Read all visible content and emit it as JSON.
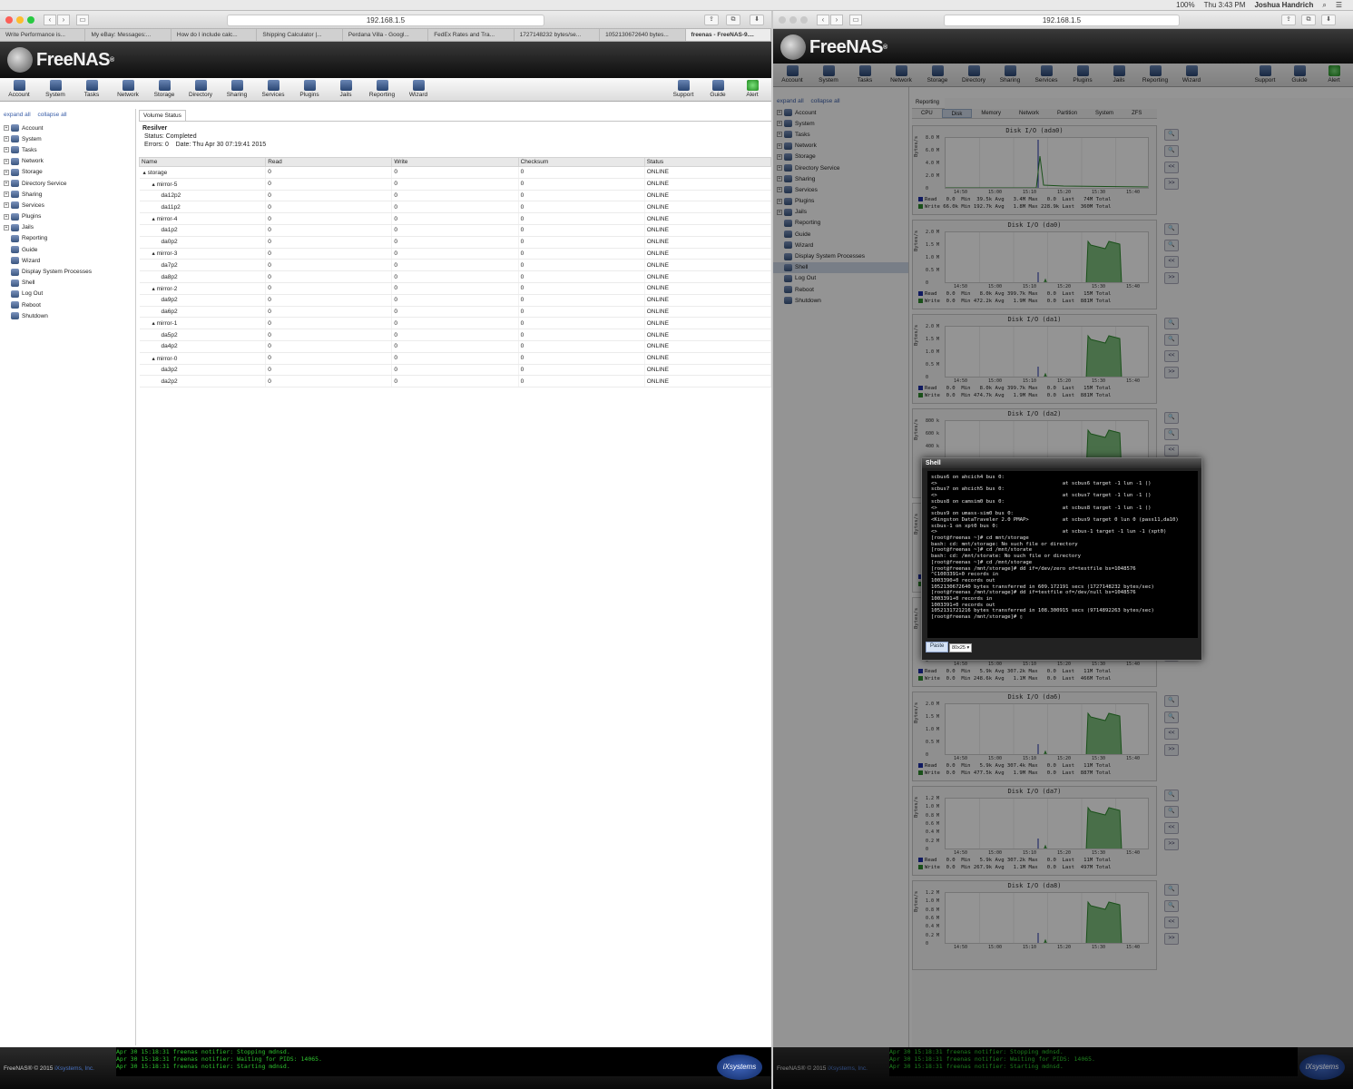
{
  "menubar": {
    "battery": "100%",
    "clock": "Thu 3:43 PM",
    "user": "Joshua Handrich"
  },
  "left_window": {
    "address": "192.168.1.5",
    "tabs": [
      "Write Performance is...",
      "My eBay: Messages:...",
      "How do I include calc...",
      "Shipping Calculator |...",
      "Perdana Villa - Googl...",
      "FedEx Rates and Tra...",
      "1727148232 bytes/se...",
      "1052130672640 bytes...",
      "freenas - FreeNAS-9...."
    ],
    "logo_text": "FreeNAS",
    "toolbar": [
      "Account",
      "System",
      "Tasks",
      "Network",
      "Storage",
      "Directory",
      "Sharing",
      "Services",
      "Plugins",
      "Jails",
      "Reporting",
      "Wizard"
    ],
    "toolbar_right": [
      "Support",
      "Guide",
      "Alert"
    ],
    "tree_links": {
      "expand": "expand all",
      "collapse": "collapse all"
    },
    "tree": [
      {
        "label": "Account",
        "exp": true
      },
      {
        "label": "System",
        "exp": true
      },
      {
        "label": "Tasks",
        "exp": true
      },
      {
        "label": "Network",
        "exp": true
      },
      {
        "label": "Storage",
        "exp": true
      },
      {
        "label": "Directory Service",
        "exp": true
      },
      {
        "label": "Sharing",
        "exp": true
      },
      {
        "label": "Services",
        "exp": true
      },
      {
        "label": "Plugins",
        "exp": true
      },
      {
        "label": "Jails",
        "exp": true
      },
      {
        "label": "Reporting",
        "exp": false
      },
      {
        "label": "Guide",
        "exp": false
      },
      {
        "label": "Wizard",
        "exp": false
      },
      {
        "label": "Display System Processes",
        "exp": false
      },
      {
        "label": "Shell",
        "exp": false
      },
      {
        "label": "Log Out",
        "exp": false
      },
      {
        "label": "Reboot",
        "exp": false
      },
      {
        "label": "Shutdown",
        "exp": false
      }
    ],
    "volume_tab": "Volume Status",
    "resilver": {
      "title": "Resilver",
      "status": "Status: Completed",
      "errors": "Errors: 0",
      "date": "Date: Thu Apr 30 07:19:41 2015"
    },
    "columns": [
      "Name",
      "Read",
      "Write",
      "Checksum",
      "Status"
    ],
    "rows": [
      {
        "name": "storage",
        "level": 0,
        "read": "0",
        "write": "0",
        "checksum": "0",
        "status": "ONLINE"
      },
      {
        "name": "mirror-5",
        "level": 1,
        "read": "0",
        "write": "0",
        "checksum": "0",
        "status": "ONLINE"
      },
      {
        "name": "da12p2",
        "level": 2,
        "read": "0",
        "write": "0",
        "checksum": "0",
        "status": "ONLINE"
      },
      {
        "name": "da11p2",
        "level": 2,
        "read": "0",
        "write": "0",
        "checksum": "0",
        "status": "ONLINE"
      },
      {
        "name": "mirror-4",
        "level": 1,
        "read": "0",
        "write": "0",
        "checksum": "0",
        "status": "ONLINE"
      },
      {
        "name": "da1p2",
        "level": 2,
        "read": "0",
        "write": "0",
        "checksum": "0",
        "status": "ONLINE"
      },
      {
        "name": "da0p2",
        "level": 2,
        "read": "0",
        "write": "0",
        "checksum": "0",
        "status": "ONLINE"
      },
      {
        "name": "mirror-3",
        "level": 1,
        "read": "0",
        "write": "0",
        "checksum": "0",
        "status": "ONLINE"
      },
      {
        "name": "da7p2",
        "level": 2,
        "read": "0",
        "write": "0",
        "checksum": "0",
        "status": "ONLINE"
      },
      {
        "name": "da8p2",
        "level": 2,
        "read": "0",
        "write": "0",
        "checksum": "0",
        "status": "ONLINE"
      },
      {
        "name": "mirror-2",
        "level": 1,
        "read": "0",
        "write": "0",
        "checksum": "0",
        "status": "ONLINE"
      },
      {
        "name": "da9p2",
        "level": 2,
        "read": "0",
        "write": "0",
        "checksum": "0",
        "status": "ONLINE"
      },
      {
        "name": "da6p2",
        "level": 2,
        "read": "0",
        "write": "0",
        "checksum": "0",
        "status": "ONLINE"
      },
      {
        "name": "mirror-1",
        "level": 1,
        "read": "0",
        "write": "0",
        "checksum": "0",
        "status": "ONLINE"
      },
      {
        "name": "da5p2",
        "level": 2,
        "read": "0",
        "write": "0",
        "checksum": "0",
        "status": "ONLINE"
      },
      {
        "name": "da4p2",
        "level": 2,
        "read": "0",
        "write": "0",
        "checksum": "0",
        "status": "ONLINE"
      },
      {
        "name": "mirror-0",
        "level": 1,
        "read": "0",
        "write": "0",
        "checksum": "0",
        "status": "ONLINE"
      },
      {
        "name": "da3p2",
        "level": 2,
        "read": "0",
        "write": "0",
        "checksum": "0",
        "status": "ONLINE"
      },
      {
        "name": "da2p2",
        "level": 2,
        "read": "0",
        "write": "0",
        "checksum": "0",
        "status": "ONLINE"
      }
    ],
    "footer_copyright": "FreeNAS® © 2015",
    "footer_company": "iXsystems, Inc.",
    "console_lines": [
      "Apr 30 15:18:31 freenas notifier: Stopping mdnsd.",
      "Apr 30 15:18:31 freenas notifier: Waiting for PIDS: 14065.",
      "Apr 30 15:18:31 freenas notifier: Starting mdnsd."
    ],
    "ix_logo": "iXsystems"
  },
  "right_window": {
    "address": "192.168.1.5",
    "logo_text": "FreeNAS",
    "toolbar": [
      "Account",
      "System",
      "Tasks",
      "Network",
      "Storage",
      "Directory",
      "Sharing",
      "Services",
      "Plugins",
      "Jails",
      "Reporting",
      "Wizard"
    ],
    "toolbar_right": [
      "Support",
      "Guide",
      "Alert"
    ],
    "tree_links": {
      "expand": "expand all",
      "collapse": "collapse all"
    },
    "tree": [
      "Account",
      "System",
      "Tasks",
      "Network",
      "Storage",
      "Directory Service",
      "Sharing",
      "Services",
      "Plugins",
      "Jails",
      "Reporting",
      "Guide",
      "Wizard",
      "Display System Processes",
      "Shell",
      "Log Out",
      "Reboot",
      "Shutdown"
    ],
    "selected": "Shell",
    "reporting_tab": "Reporting",
    "report_tabs": [
      "CPU",
      "Disk",
      "Memory",
      "Network",
      "Partition",
      "System",
      "ZFS"
    ],
    "active_report_tab": "Disk",
    "graphs": [
      {
        "title": "Disk I/O (ada0)",
        "yticks": [
          "8.0 M",
          "6.0 M",
          "4.0 M",
          "2.0 M",
          "0"
        ],
        "read": "Read   0.0  Min  39.5k Avg   3.4M Max   0.0  Last   74M Total",
        "write": "Write 66.0k Min 192.7k Avg   1.8M Max 228.9k Last  360M Total"
      },
      {
        "title": "Disk I/O (da0)",
        "yticks": [
          "2.0 M",
          "1.5 M",
          "1.0 M",
          "0.5 M",
          "0"
        ],
        "read": "Read   0.0  Min   8.0k Avg 399.7k Max   0.0  Last   15M Total",
        "write": "Write  0.0  Min 472.2k Avg   1.9M Max   0.0  Last  881M Total"
      },
      {
        "title": "Disk I/O (da1)",
        "yticks": [
          "2.0 M",
          "1.5 M",
          "1.0 M",
          "0.5 M",
          "0"
        ],
        "read": "Read   0.0  Min   8.0k Avg 399.7k Max   0.0  Last   15M Total",
        "write": "Write  0.0  Min 474.7k Avg   1.9M Max   0.0  Last  881M Total"
      },
      {
        "title": "Disk I/O (da2)",
        "yticks": [
          "800 k",
          "600 k",
          "400 k",
          "",
          ""
        ],
        "read": "",
        "write": ""
      },
      {
        "title": "",
        "yticks": [
          "",
          "",
          "",
          "",
          ""
        ],
        "read": "Read   0.0  Min   5.9k Avg 307.2k Max   0.0  Last   11M Total",
        "write": "Write  0.0  Min 249.9k Avg   1.1M Max   0.0  Last  466M Total"
      },
      {
        "title": "Disk I/O (da5)",
        "yticks": [
          "1.2 M",
          "1.0 M",
          "0.8 M",
          "0.6 M",
          "0.4 M",
          "0.2 M",
          "0"
        ],
        "read": "Read   0.0  Min   5.9k Avg 307.2k Max   0.0  Last   11M Total",
        "write": "Write  0.0  Min 248.6k Avg   1.1M Max   0.0  Last  466M Total"
      },
      {
        "title": "Disk I/O (da6)",
        "yticks": [
          "2.0 M",
          "1.5 M",
          "1.0 M",
          "0.5 M",
          "0"
        ],
        "read": "Read   0.0  Min   5.9k Avg 307.4k Max   0.0  Last   11M Total",
        "write": "Write  0.0  Min 477.5k Avg   1.9M Max   0.0  Last  887M Total"
      },
      {
        "title": "Disk I/O (da7)",
        "yticks": [
          "1.2 M",
          "1.0 M",
          "0.8 M",
          "0.6 M",
          "0.4 M",
          "0.2 M",
          "0"
        ],
        "read": "Read   0.0  Min   5.9k Avg 307.2k Max   0.0  Last   11M Total",
        "write": "Write  0.0  Min 267.9k Avg   1.1M Max   0.0  Last  497M Total"
      },
      {
        "title": "Disk I/O (da8)",
        "yticks": [
          "1.2 M",
          "1.0 M",
          "0.8 M",
          "0.6 M",
          "0.4 M",
          "0.2 M",
          "0"
        ],
        "read": "",
        "write": ""
      }
    ],
    "x_ticks": [
      "14:50",
      "15:00",
      "15:10",
      "15:20",
      "15:30",
      "15:40"
    ],
    "y_axis_label": "Bytes/s",
    "graph_buttons": [
      "🔍",
      "🔍",
      "<<",
      ">>"
    ],
    "shell": {
      "title": "Shell",
      "lines": [
        "",
        "scbus6 on ahcich4 bus 0:",
        "<>                                         at scbus6 target -1 lun -1 ()",
        "scbus7 on ahcich5 bus 0:",
        "<>                                         at scbus7 target -1 lun -1 ()",
        "scbus8 on camsim0 bus 0:",
        "<>                                         at scbus8 target -1 lun -1 ()",
        "scbus9 on umass-sim0 bus 0:",
        "<Kingston DataTraveler 2.0 PMAP>           at scbus9 target 0 lun 0 (pass11,da10)",
        "scbus-1 on xpt0 bus 0:",
        "<>                                         at scbus-1 target -1 lun -1 (xpt0)",
        "[root@freenas ~]# cd mnt/storage",
        "bash: cd: mnt/storage: No such file or directory",
        "[root@freenas ~]# cd /mnt/storate",
        "bash: cd: /mnt/storate: No such file or directory",
        "[root@freenas ~]# cd /mnt/storage",
        "[root@freenas /mnt/storage]# dd if=/dev/zero of=testfile bs=1048576",
        "^C1003391+0 records in",
        "1003390+0 records out",
        "1052130672640 bytes transferred in 609.172191 secs (1727148232 bytes/sec)",
        "[root@freenas /mnt/storage]# dd if=testfile of=/dev/null bs=1048576",
        "1003391+0 records in",
        "1003391+0 records out",
        "1052131721216 bytes transferred in 108.300915 secs (9714892263 bytes/sec)",
        "[root@freenas /mnt/storage]# ▯"
      ],
      "paste_label": "Paste",
      "size_value": "80x25"
    },
    "footer_copyright": "FreeNAS® © 2015",
    "footer_company": "iXsystems, Inc.",
    "console_lines": [
      "Apr 30 15:18:31 freenas notifier: Stopping mdnsd.",
      "Apr 30 15:18:31 freenas notifier: Waiting for PIDS: 14065.",
      "Apr 30 15:18:31 freenas notifier: Starting mdnsd."
    ],
    "ix_logo": "iXsystems"
  },
  "colors": {
    "read": "#1c2ea6",
    "write": "#2e8b2e",
    "write_fill": "#7fbf7f",
    "console_text": "#2ec22e"
  }
}
